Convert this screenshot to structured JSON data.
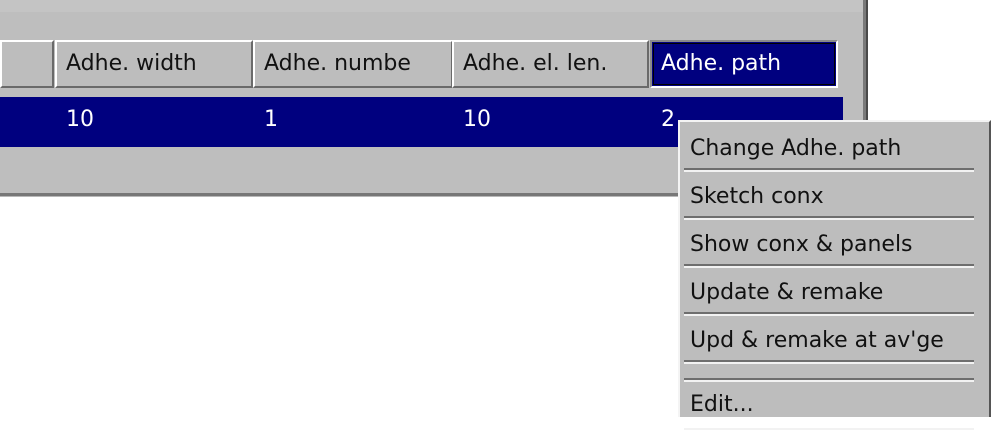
{
  "table": {
    "columns": [
      "Adhe. width",
      "Adhe. numbe",
      "Adhe. el. len.",
      "Adhe. path"
    ],
    "selected_column": "Adhe. path",
    "selected_row": [
      "10",
      "1",
      "10",
      "2"
    ]
  },
  "context_menu": {
    "items": [
      "Change Adhe. path",
      "Sketch conx",
      "Show conx & panels",
      "Update & remake",
      "Upd & remake at av'ge",
      "Edit..."
    ]
  },
  "colors": {
    "selection": "#00007f",
    "panel": "#bebebe",
    "menu": "#bdbdbd"
  }
}
